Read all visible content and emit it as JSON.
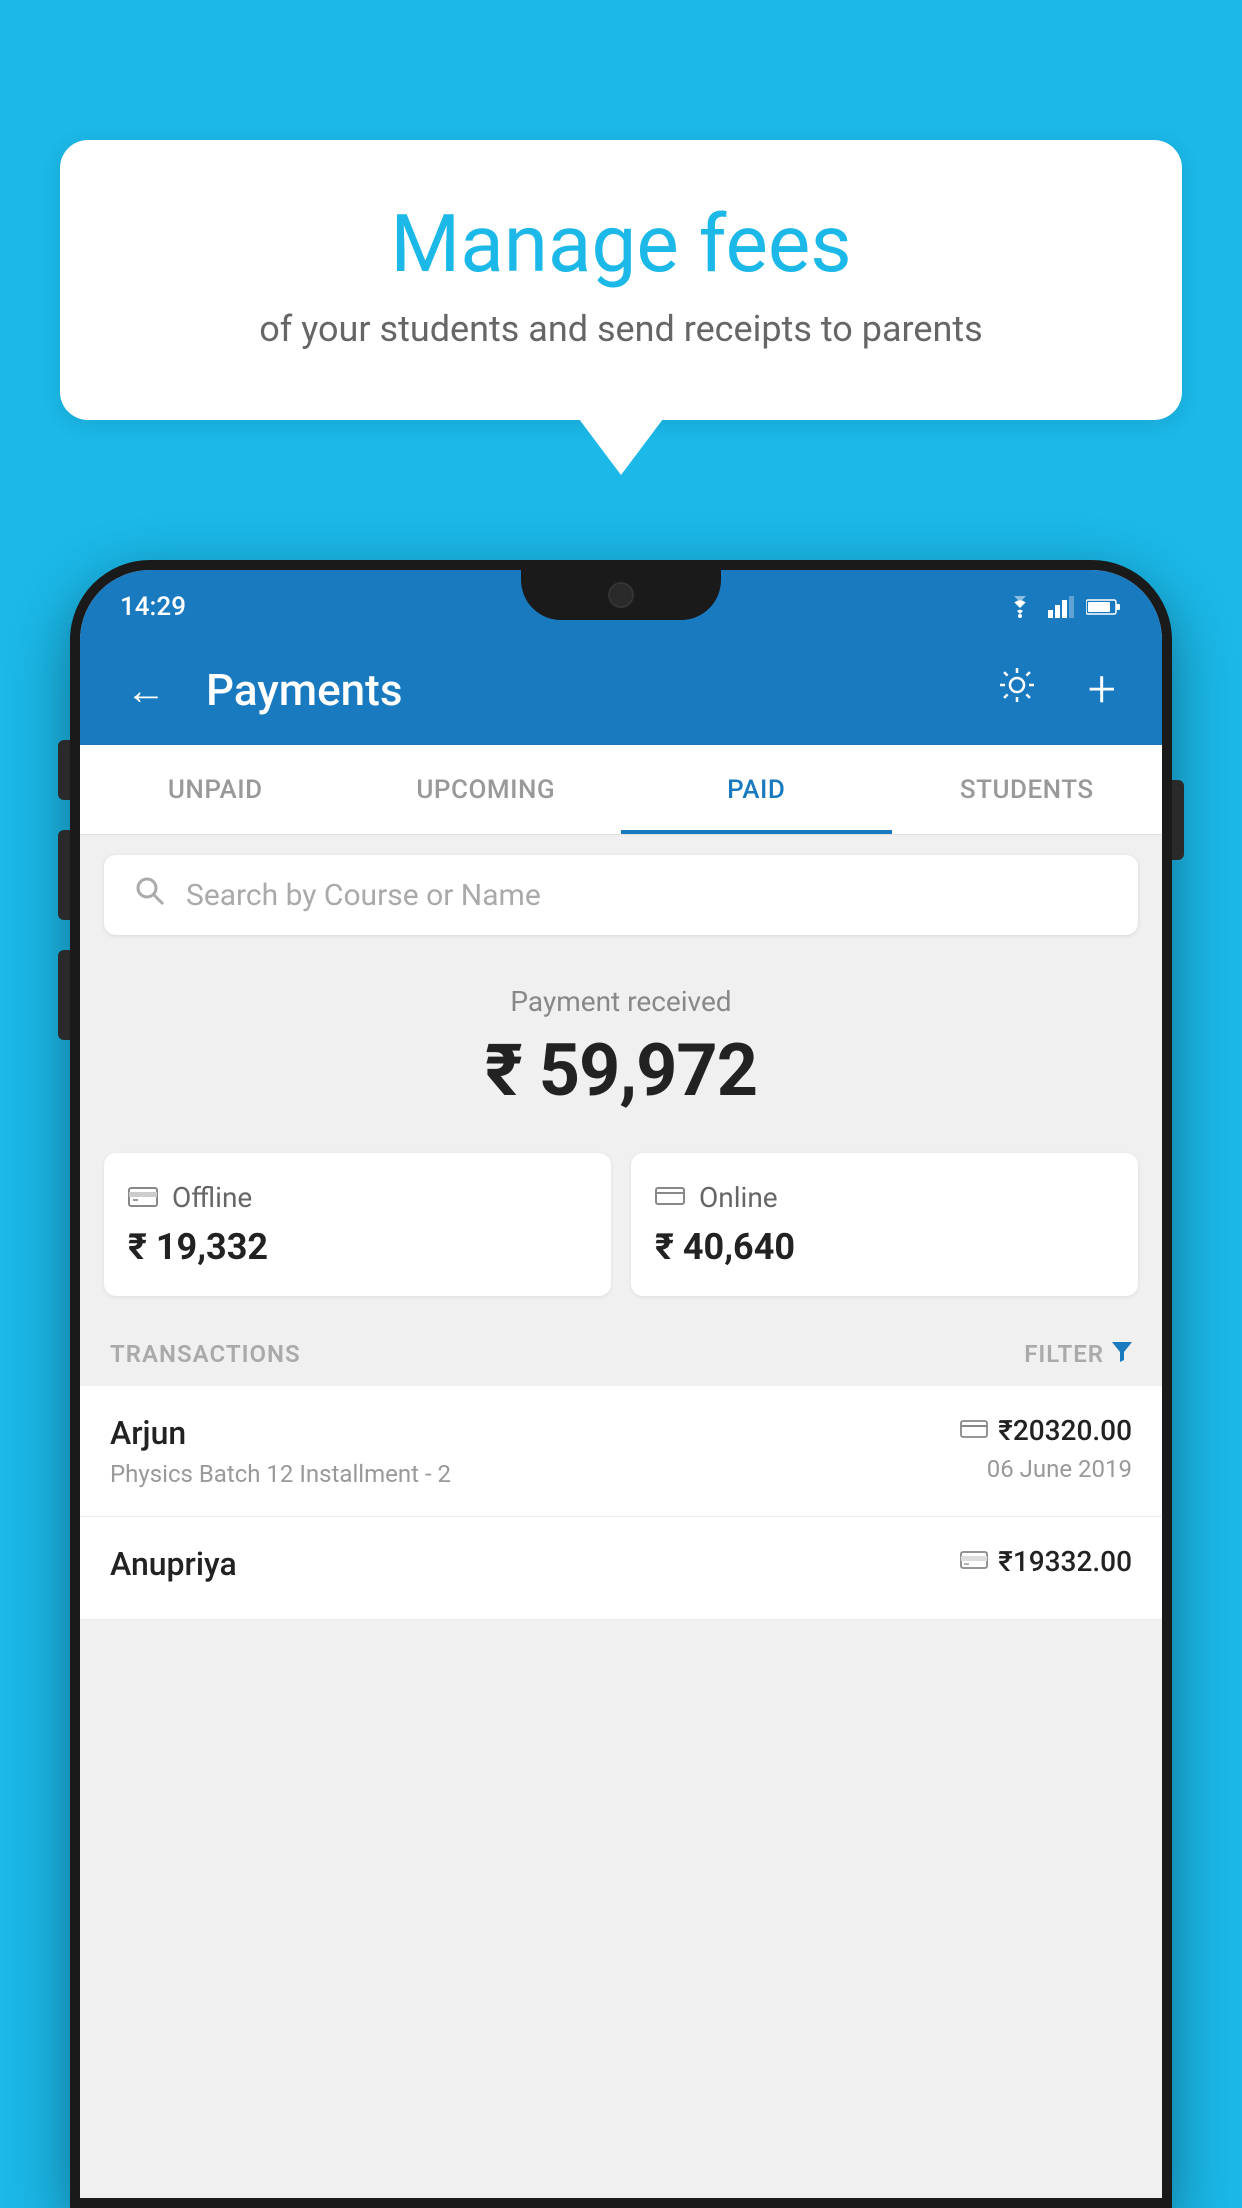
{
  "background_color": "#1bb8e8",
  "bubble": {
    "title": "Manage fees",
    "subtitle": "of your students and send receipts to parents"
  },
  "status_bar": {
    "time": "14:29",
    "wifi": "▾",
    "signal": "▴",
    "battery": "▮"
  },
  "app_bar": {
    "title": "Payments",
    "back_icon": "←",
    "gear_icon": "⚙",
    "plus_icon": "+"
  },
  "tabs": [
    {
      "label": "UNPAID",
      "active": false
    },
    {
      "label": "UPCOMING",
      "active": false
    },
    {
      "label": "PAID",
      "active": true
    },
    {
      "label": "STUDENTS",
      "active": false
    }
  ],
  "search": {
    "placeholder": "Search by Course or Name"
  },
  "payment_summary": {
    "label": "Payment received",
    "amount": "₹ 59,972"
  },
  "payment_cards": [
    {
      "type": "offline",
      "label": "Offline",
      "amount": "₹ 19,332"
    },
    {
      "type": "online",
      "label": "Online",
      "amount": "₹ 40,640"
    }
  ],
  "transactions": {
    "header": "TRANSACTIONS",
    "filter_label": "FILTER",
    "rows": [
      {
        "name": "Arjun",
        "detail": "Physics Batch 12 Installment - 2",
        "amount": "₹20320.00",
        "date": "06 June 2019",
        "payment_type": "online"
      },
      {
        "name": "Anupriya",
        "detail": "",
        "amount": "₹19332.00",
        "date": "",
        "payment_type": "offline"
      }
    ]
  }
}
